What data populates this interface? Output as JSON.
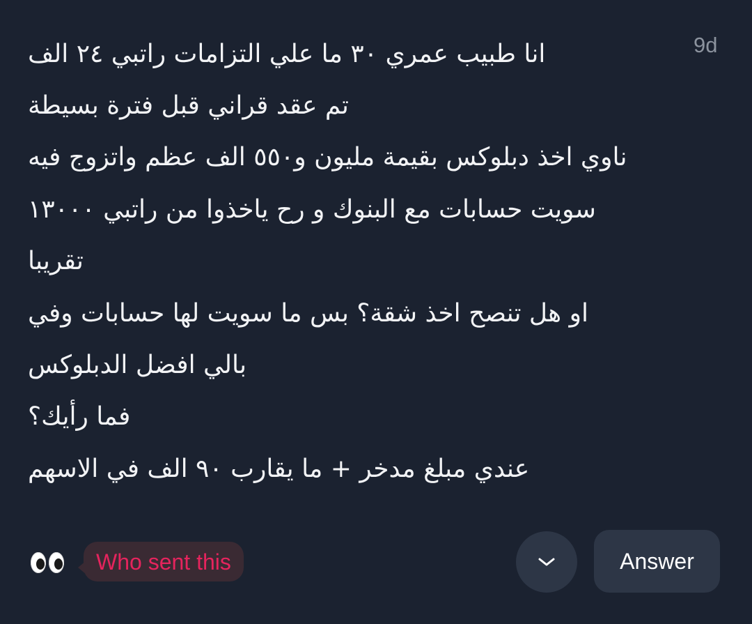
{
  "header": {
    "age": "9d"
  },
  "message": {
    "lines": [
      "انا طبيب عمري ٣٠ ما علي التزامات راتبي ٢٤ الف",
      "تم عقد قراني قبل فترة بسيطة",
      "ناوي اخذ دبلوكس بقيمة مليون و٥٥٠ الف عظم واتزوج فيه",
      "سويت حسابات مع البنوك و رح ياخذوا من راتبي ١٣٠٠٠",
      "تقريبا",
      "او هل تنصح اخذ شقة؟ بس ما سويت لها حسابات وفي",
      "بالي افضل الدبلوكس",
      "فما رأيك؟",
      "عندي مبلغ مدخر + ما يقارب ٩٠ الف في الاسهم"
    ]
  },
  "footer": {
    "reaction_icon": "eyes-emoji",
    "who_sent_label": "Who sent this",
    "dropdown_icon": "chevron-down-icon",
    "answer_label": "Answer"
  },
  "colors": {
    "background": "#1b2230",
    "text": "#f2f3f5",
    "muted": "#8c939e",
    "button": "#2d3646",
    "accent": "#e5245d"
  }
}
